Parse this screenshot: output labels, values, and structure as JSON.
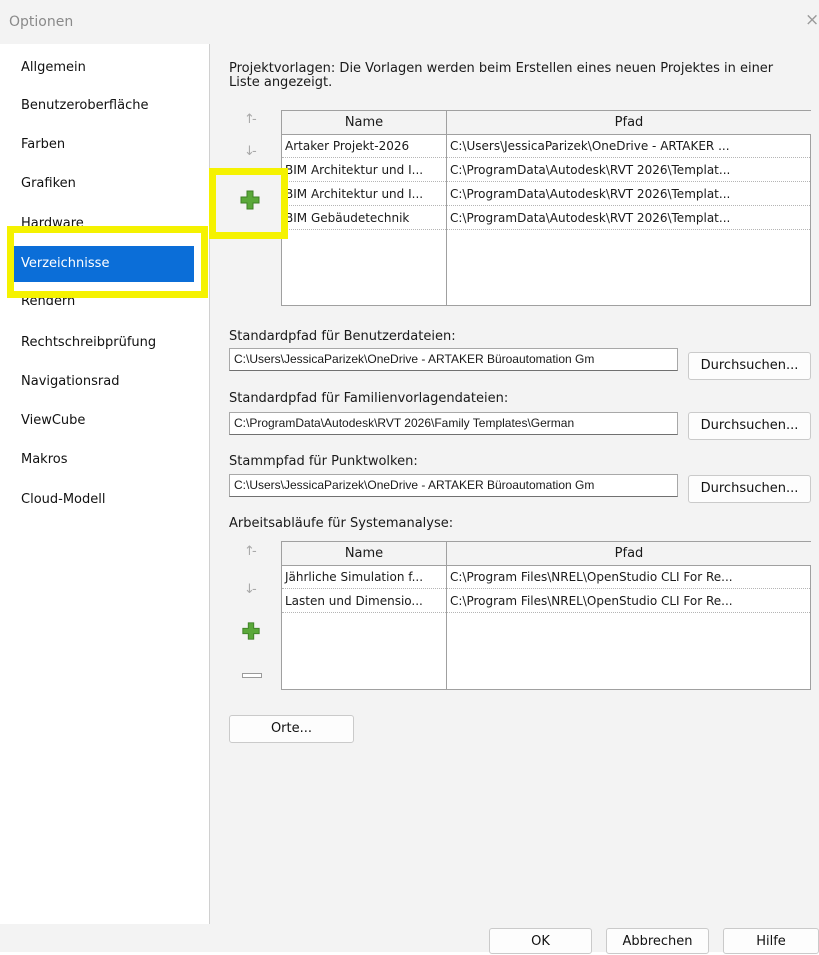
{
  "window": {
    "title": "Optionen",
    "close_glyph": "×"
  },
  "sidebar": {
    "items": [
      {
        "label": "Allgemein"
      },
      {
        "label": "Benutzeroberfläche"
      },
      {
        "label": "Farben"
      },
      {
        "label": "Grafiken"
      },
      {
        "label": "Hardware"
      },
      {
        "label": "Verzeichnisse",
        "selected": true
      },
      {
        "label": "Rendern"
      },
      {
        "label": "Rechtschreibprüfung"
      },
      {
        "label": "Navigationsrad"
      },
      {
        "label": "ViewCube"
      },
      {
        "label": "Makros"
      },
      {
        "label": "Cloud-Modell"
      }
    ]
  },
  "project_templates": {
    "description": "Projektvorlagen: Die Vorlagen werden beim Erstellen eines neuen Projektes in einer Liste angezeigt.",
    "columns": [
      "Name",
      "Pfad"
    ],
    "rows": [
      {
        "name": "Artaker Projekt-2026",
        "path": "C:\\Users\\JessicaParizek\\OneDrive - ARTAKER ..."
      },
      {
        "name": "BIM Architektur und I...",
        "path": "C:\\ProgramData\\Autodesk\\RVT 2026\\Templat..."
      },
      {
        "name": "BIM Architektur und I...",
        "path": "C:\\ProgramData\\Autodesk\\RVT 2026\\Templat..."
      },
      {
        "name": "BIM Gebäudetechnik",
        "path": "C:\\ProgramData\\Autodesk\\RVT 2026\\Templat..."
      }
    ]
  },
  "user_files": {
    "label": "Standardpfad für Benutzerdateien:",
    "value": "C:\\Users\\JessicaParizek\\OneDrive - ARTAKER Büroautomation Gm",
    "browse": "Durchsuchen..."
  },
  "family_templates": {
    "label": "Standardpfad für Familienvorlagendateien:",
    "value": "C:\\ProgramData\\Autodesk\\RVT 2026\\Family Templates\\German",
    "browse": "Durchsuchen..."
  },
  "point_clouds": {
    "label": "Stammpfad für Punktwolken:",
    "value": "C:\\Users\\JessicaParizek\\OneDrive - ARTAKER Büroautomation Gm",
    "browse": "Durchsuchen..."
  },
  "workflows": {
    "label": "Arbeitsabläufe für Systemanalyse:",
    "columns": [
      "Name",
      "Pfad"
    ],
    "rows": [
      {
        "name": "Jährliche Simulation f...",
        "path": "C:\\Program Files\\NREL\\OpenStudio CLI For Re..."
      },
      {
        "name": "Lasten und Dimensio...",
        "path": "C:\\Program Files\\NREL\\OpenStudio CLI For Re..."
      }
    ]
  },
  "places_button": "Orte...",
  "footer": {
    "ok": "OK",
    "cancel": "Abbrechen",
    "help": "Hilfe"
  },
  "colors": {
    "selected": "#0b6ed8",
    "highlight": "#f5f200",
    "add_icon": "#5aa83a"
  }
}
